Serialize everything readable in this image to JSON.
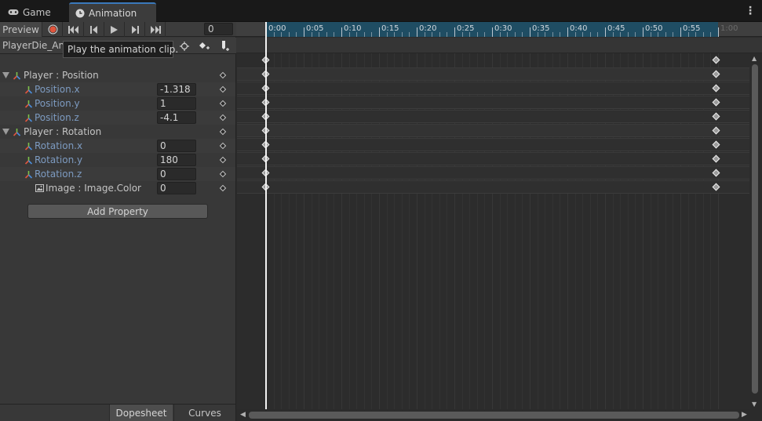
{
  "tabs": {
    "game_label": "Game",
    "animation_label": "Animation"
  },
  "toolbar": {
    "preview_label": "Preview",
    "frame_value": "0"
  },
  "clip": {
    "name": "PlayerDie_Ani"
  },
  "tooltip": "Play the animation clip.",
  "properties": [
    {
      "label": "Player : Position",
      "value": null
    },
    {
      "label": "Position.x",
      "value": "-1.318"
    },
    {
      "label": "Position.y",
      "value": "1"
    },
    {
      "label": "Position.z",
      "value": "-4.1"
    },
    {
      "label": "Player : Rotation",
      "value": null
    },
    {
      "label": "Rotation.x",
      "value": "0"
    },
    {
      "label": "Rotation.y",
      "value": "180"
    },
    {
      "label": "Rotation.z",
      "value": "0"
    },
    {
      "label": "Image : Image.Color",
      "value": "0"
    }
  ],
  "add_property_label": "Add Property",
  "bottom_tabs": {
    "dopesheet": "Dopesheet",
    "curves": "Curves"
  },
  "ruler": {
    "labels": [
      "0:00",
      "0:05",
      "0:10",
      "0:15",
      "0:20",
      "0:25",
      "0:30",
      "0:35",
      "0:40",
      "0:45",
      "0:50",
      "0:55",
      "1:00"
    ]
  },
  "colors": {
    "record": "#e0553d",
    "accent": "#3a79bb",
    "ruler_active": "#1f4d63"
  },
  "icons": [
    "gamepad-icon",
    "clock-icon",
    "record-icon",
    "first-key-icon",
    "prev-key-icon",
    "play-icon",
    "next-key-icon",
    "last-key-icon",
    "filter-icon",
    "add-keyframe-icon",
    "add-event-icon",
    "transform-icon",
    "image-icon",
    "kebab-menu-icon"
  ]
}
